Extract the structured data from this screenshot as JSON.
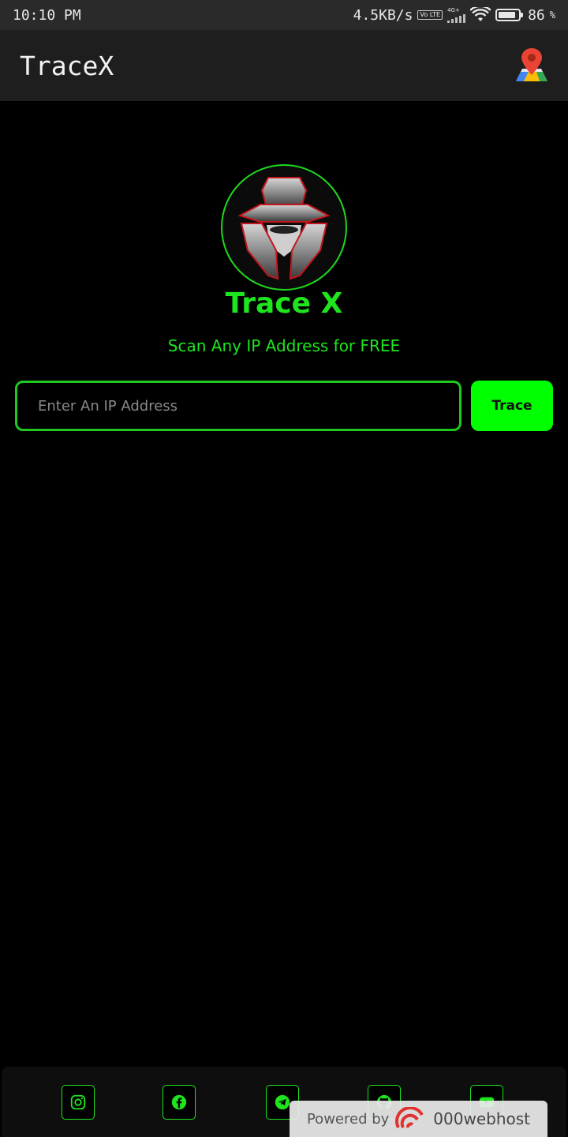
{
  "status_bar": {
    "time": "10:10 PM",
    "net_speed": "4.5KB/s",
    "volte": "Vo LTE",
    "network_type": "4G+",
    "battery_level": "86",
    "battery_unit": "%"
  },
  "app_bar": {
    "title": "TraceX",
    "map_icon": "map-pin-icon"
  },
  "hero": {
    "title": "Trace X",
    "subtitle": "Scan Any IP Address for FREE"
  },
  "search": {
    "placeholder": "Enter An IP Address",
    "value": "",
    "button_label": "Trace"
  },
  "footer": {
    "socials": [
      "instagram-icon",
      "facebook-icon",
      "telegram-icon",
      "github-icon",
      "youtube-icon"
    ],
    "powered_by": "Powered by",
    "host_brand": "000webhost"
  },
  "colors": {
    "accent": "#00ff00",
    "text_accent": "#1ee51e",
    "background": "#000000",
    "app_bar": "#1e1e1e"
  }
}
